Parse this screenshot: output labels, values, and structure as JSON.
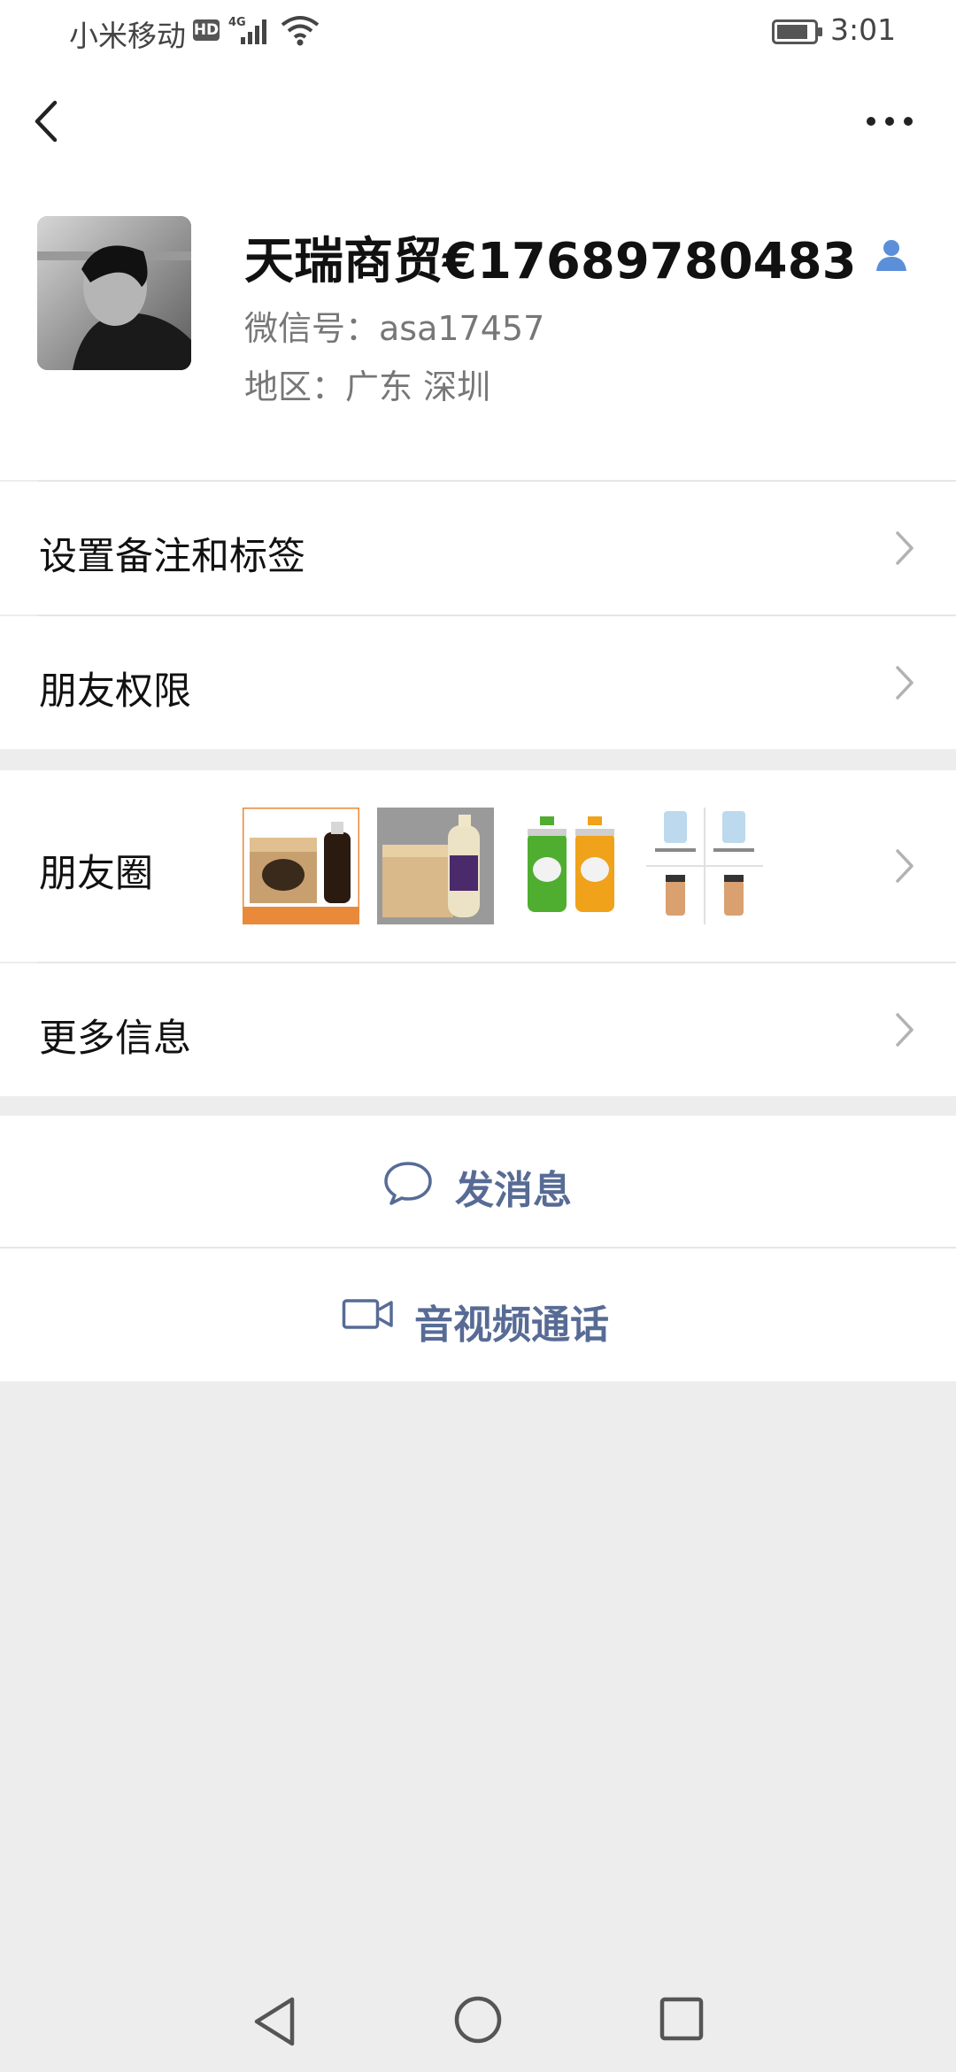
{
  "status_bar": {
    "carrier": "小米移动",
    "hd": "HD",
    "network": "4G",
    "time": "3:01"
  },
  "nav": {
    "back_icon": "chevron-left-icon",
    "more_icon": "more-dots-icon"
  },
  "profile": {
    "name": "天瑞商贸€17689780483",
    "wechat_id": "微信号：asa17457",
    "region": "地区：广东  深圳"
  },
  "menu": {
    "remark_label": "设置备注和标签",
    "permissions_label": "朋友权限",
    "moments_label": "朋友圈",
    "more_info_label": "更多信息"
  },
  "actions": {
    "message_label": "发消息",
    "call_label": "音视频通话"
  },
  "colors": {
    "link": "#576b95",
    "background": "#ededed",
    "contact_icon": "#5b8fd9"
  }
}
